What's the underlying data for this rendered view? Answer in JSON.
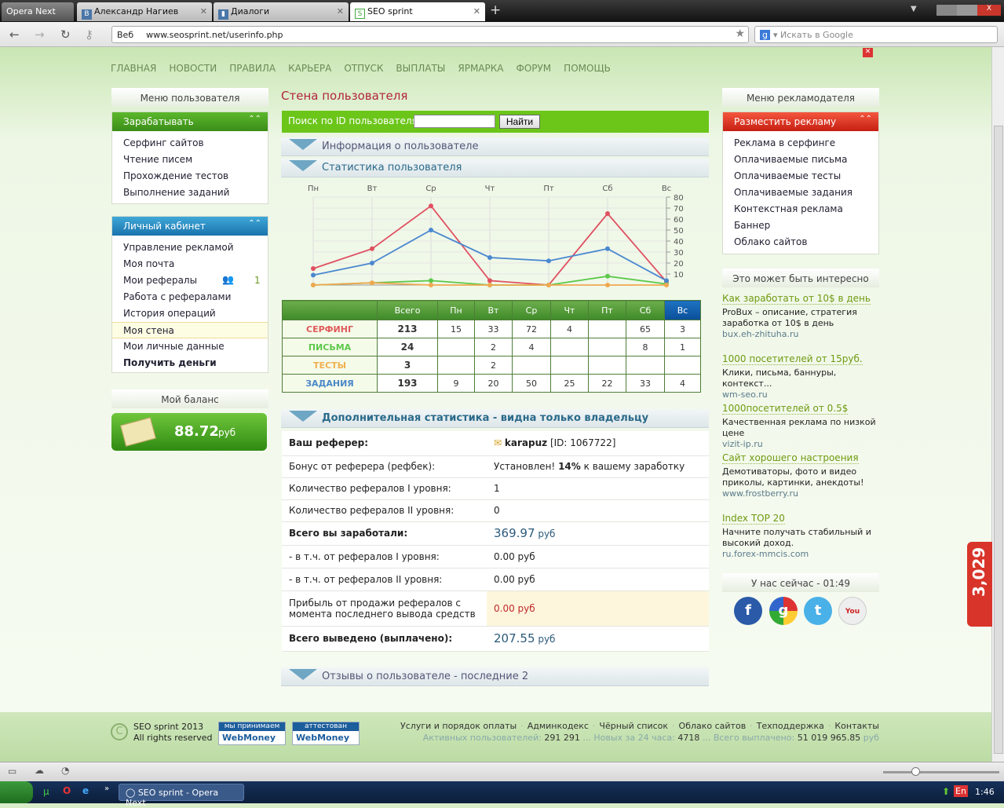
{
  "browser": {
    "opera_button": "Opera Next",
    "tabs": [
      {
        "label": "Александр Нагиев"
      },
      {
        "label": "Диалоги"
      },
      {
        "label": "SEO sprint",
        "active": true
      }
    ],
    "address_prefix": "Веб",
    "url": "www.seosprint.net/userinfo.php",
    "search_placeholder": "Искать в Google"
  },
  "topnav": [
    "ГЛАВНАЯ",
    "НОВОСТИ",
    "ПРАВИЛА",
    "КАРЬЕРА",
    "ОТПУСК",
    "ВЫПЛАТЫ",
    "ЯРМАРКА",
    "ФОРУМ",
    "ПОМОЩЬ"
  ],
  "left": {
    "title": "Меню пользователя",
    "earn": {
      "head": "Зарабатывать",
      "items": [
        "Серфинг сайтов",
        "Чтение писем",
        "Прохождение тестов",
        "Выполнение заданий"
      ]
    },
    "cabinet": {
      "head": "Личный кабинет",
      "items": [
        "Управление рекламой",
        "Моя почта",
        "Мои рефералы",
        "Работа с рефералами",
        "История операций",
        "Моя стена",
        "Мои личные данные",
        "Получить деньги"
      ],
      "referrals_count": "1"
    },
    "balance_title": "Мой баланс",
    "balance": "88.72",
    "currency": "руб"
  },
  "center": {
    "title": "Стена пользователя",
    "search_label": "Поиск по ID пользователя:",
    "search_value": "",
    "search_button": "Найти",
    "sec_info": "Информация о пользователе",
    "sec_stats": "Статистика пользователя",
    "table": {
      "headers": [
        "",
        "Всего",
        "Пн",
        "Вт",
        "Ср",
        "Чт",
        "Пт",
        "Сб",
        "Вс"
      ],
      "rows": [
        {
          "label": "СЕРФИНГ",
          "color": "#e05a5a",
          "cells": [
            "213",
            "15",
            "33",
            "72",
            "4",
            "",
            "65",
            "3"
          ]
        },
        {
          "label": "ПИСЬМА",
          "color": "#5cc84a",
          "cells": [
            "24",
            "",
            "2",
            "4",
            "",
            "",
            "8",
            "1"
          ]
        },
        {
          "label": "ТЕСТЫ",
          "color": "#f0b050",
          "cells": [
            "3",
            "",
            "2",
            "",
            "",
            "",
            "",
            ""
          ]
        },
        {
          "label": "ЗАДАНИЯ",
          "color": "#4a88c8",
          "cells": [
            "193",
            "9",
            "20",
            "50",
            "25",
            "22",
            "33",
            "4"
          ]
        }
      ]
    },
    "sec_extra": "Дополнительная статистика - видна только владельцу",
    "extra": {
      "referrer_label": "Ваш реферер:",
      "referrer_name": "karapuz",
      "referrer_id": "[ID: 1067722]",
      "bonus_label": "Бонус от реферера (рефбек):",
      "bonus_pre": "Установлен!",
      "bonus_pct": "14%",
      "bonus_post": "к вашему заработку",
      "ref1_label": "Количество рефералов I уровня:",
      "ref1": "1",
      "ref2_label": "Количество рефералов II уровня:",
      "ref2": "0",
      "earned_label": "Всего вы заработали:",
      "earned": "369.97",
      "from1_label": "- в т.ч. от рефералов I уровня:",
      "from1": "0.00",
      "from2_label": "- в т.ч. от рефералов II уровня:",
      "from2": "0.00",
      "sale_label": "Прибыль от продажи рефералов с момента последнего вывода средств",
      "sale": "0.00",
      "paid_label": "Всего выведено (выплачено):",
      "paid": "207.55",
      "currency": "руб"
    },
    "sec_reviews": "Отзывы о пользователе - последние 2"
  },
  "chart_data": {
    "type": "line",
    "categories": [
      "Пн",
      "Вт",
      "Ср",
      "Чт",
      "Пт",
      "Сб",
      "Вс"
    ],
    "ylim": [
      0,
      80
    ],
    "yticks": [
      "10",
      "20",
      "30",
      "40",
      "50",
      "60",
      "70",
      "80"
    ],
    "grid": true,
    "series": [
      {
        "key": "surfing",
        "color": "#e05060",
        "values": [
          15,
          33,
          72,
          4,
          0,
          65,
          3
        ]
      },
      {
        "key": "letters",
        "color": "#5cc84a",
        "values": [
          0,
          2,
          4,
          0,
          0,
          8,
          1
        ]
      },
      {
        "key": "tests",
        "color": "#f0a850",
        "values": [
          0,
          2,
          0,
          0,
          0,
          0,
          0
        ]
      },
      {
        "key": "tasks",
        "color": "#4a88d0",
        "values": [
          9,
          20,
          50,
          25,
          22,
          33,
          4
        ]
      }
    ]
  },
  "right": {
    "title": "Меню рекламодателя",
    "head": "Разместить рекламу",
    "items": [
      "Реклама в серфинге",
      "Оплачиваемые письма",
      "Оплачиваемые тесты",
      "Оплачиваемые задания",
      "Контекстная реклама",
      "Баннер",
      "Облако сайтов"
    ],
    "interesting": "Это может быть интересно",
    "ads": [
      {
        "title": "Как заработать от 10$ в день",
        "text": "ProBux – описание, стратегия заработка от 10$ в день",
        "url": "bux.eh-zhituha.ru"
      },
      {
        "title": "1000 посетителей от 15руб.",
        "text": "Клики, письма, баннуры, контекст...",
        "url": "wm-seo.ru"
      },
      {
        "title": "1000посетителей от 0.5$",
        "text": "Качественная реклама по низкой цене",
        "url": "vizit-ip.ru"
      },
      {
        "title": "Сайт хорошего настроения",
        "text": "Демотиваторы, фото и видео приколы, картинки, анекдоты!",
        "url": "www.frostberry.ru"
      },
      {
        "title": "Index TOP 20",
        "text": "Начните получать стабильный и высокий доход.",
        "url": "ru.forex-mmcis.com"
      }
    ],
    "now": "У нас сейчас - 01:49"
  },
  "side_counter": "3,029",
  "footer": {
    "copyright1": "SEO sprint 2013",
    "copyright2": "All rights reserved",
    "wm1_top": "мы принимаем",
    "wm2_top": "аттестован",
    "wm_brand": "WebMoney",
    "links": [
      "Услуги и порядок оплаты",
      "Админкодекс",
      "Чёрный список",
      "Облако сайтов",
      "Техподдержка",
      "Контакты"
    ],
    "active_label": "Активных пользователей:",
    "active": "291 291",
    "new_label": "... Новых за 24 часа:",
    "new": "4718",
    "paid_label": "... Всего выплачено:",
    "paid": "51 019 965.85",
    "currency": "руб"
  },
  "taskbar": {
    "window": "SEO sprint - Opera Next",
    "lang": "En",
    "time": "1:46"
  }
}
